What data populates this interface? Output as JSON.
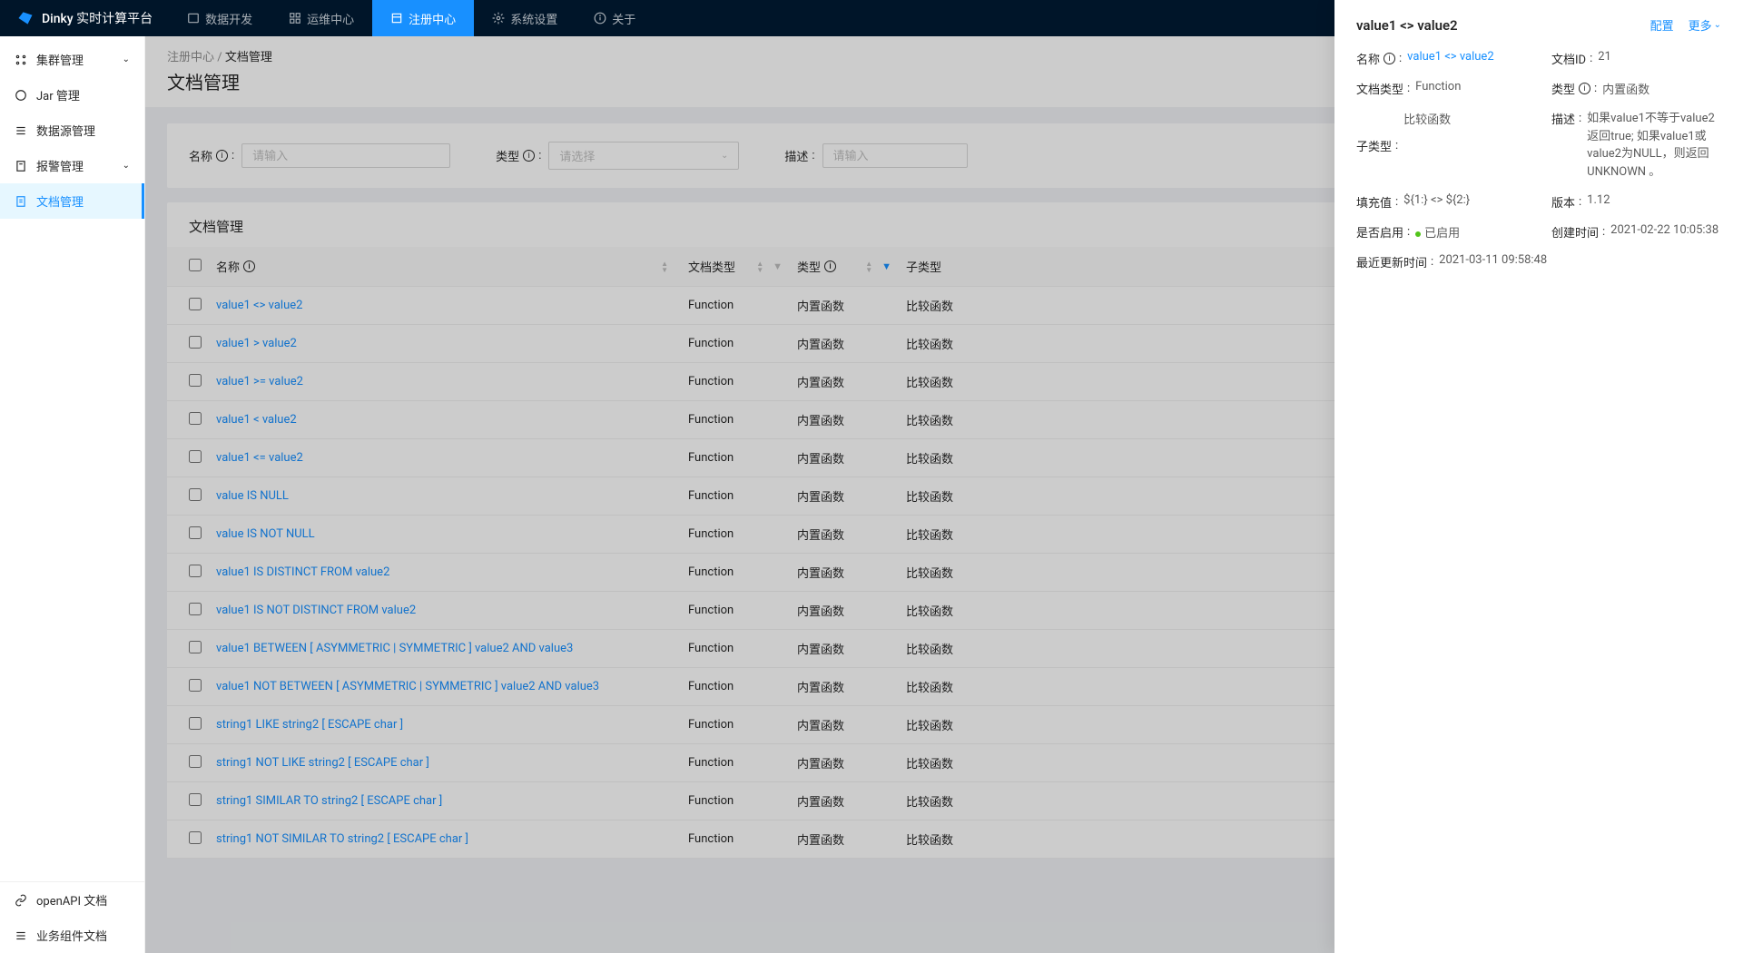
{
  "app": {
    "name": "Dinky 实时计算平台"
  },
  "nav": {
    "items": [
      {
        "label": "数据开发"
      },
      {
        "label": "运维中心"
      },
      {
        "label": "注册中心"
      },
      {
        "label": "系统设置"
      },
      {
        "label": "关于"
      }
    ]
  },
  "sidebar": {
    "items": [
      {
        "label": "集群管理",
        "expandable": true
      },
      {
        "label": "Jar 管理"
      },
      {
        "label": "数据源管理"
      },
      {
        "label": "报警管理",
        "expandable": true
      },
      {
        "label": "文档管理",
        "active": true
      }
    ],
    "bottom": [
      {
        "label": "openAPI 文档"
      },
      {
        "label": "业务组件文档"
      }
    ]
  },
  "breadcrumb": {
    "parent": "注册中心",
    "current": "文档管理"
  },
  "page": {
    "title": "文档管理"
  },
  "filters": {
    "name_label": "名称",
    "name_placeholder": "请输入",
    "type_label": "类型",
    "type_placeholder": "请选择",
    "desc_label": "描述",
    "desc_placeholder": "请输入"
  },
  "table": {
    "title": "文档管理",
    "columns": {
      "name": "名称",
      "doc_type": "文档类型",
      "type": "类型",
      "sub_type": "子类型"
    },
    "rows": [
      {
        "name": "value1 <> value2",
        "doc_type": "Function",
        "type": "内置函数",
        "sub_type": "比较函数"
      },
      {
        "name": "value1 > value2",
        "doc_type": "Function",
        "type": "内置函数",
        "sub_type": "比较函数"
      },
      {
        "name": "value1 >= value2",
        "doc_type": "Function",
        "type": "内置函数",
        "sub_type": "比较函数"
      },
      {
        "name": "value1 < value2",
        "doc_type": "Function",
        "type": "内置函数",
        "sub_type": "比较函数"
      },
      {
        "name": "value1 <= value2",
        "doc_type": "Function",
        "type": "内置函数",
        "sub_type": "比较函数"
      },
      {
        "name": "value IS NULL",
        "doc_type": "Function",
        "type": "内置函数",
        "sub_type": "比较函数"
      },
      {
        "name": "value IS NOT NULL",
        "doc_type": "Function",
        "type": "内置函数",
        "sub_type": "比较函数"
      },
      {
        "name": "value1 IS DISTINCT FROM value2",
        "doc_type": "Function",
        "type": "内置函数",
        "sub_type": "比较函数"
      },
      {
        "name": "value1 IS NOT DISTINCT FROM value2",
        "doc_type": "Function",
        "type": "内置函数",
        "sub_type": "比较函数"
      },
      {
        "name": "value1 BETWEEN [ ASYMMETRIC | SYMMETRIC ] value2 AND value3",
        "doc_type": "Function",
        "type": "内置函数",
        "sub_type": "比较函数"
      },
      {
        "name": "value1 NOT BETWEEN [ ASYMMETRIC | SYMMETRIC ] value2 AND value3",
        "doc_type": "Function",
        "type": "内置函数",
        "sub_type": "比较函数"
      },
      {
        "name": "string1 LIKE string2 [ ESCAPE char ]",
        "doc_type": "Function",
        "type": "内置函数",
        "sub_type": "比较函数"
      },
      {
        "name": "string1 NOT LIKE string2 [ ESCAPE char ]",
        "doc_type": "Function",
        "type": "内置函数",
        "sub_type": "比较函数"
      },
      {
        "name": "string1 SIMILAR TO string2 [ ESCAPE char ]",
        "doc_type": "Function",
        "type": "内置函数",
        "sub_type": "比较函数"
      },
      {
        "name": "string1 NOT SIMILAR TO string2 [ ESCAPE char ]",
        "doc_type": "Function",
        "type": "内置函数",
        "sub_type": "比较函数"
      }
    ]
  },
  "drawer": {
    "title": "value1 <> value2",
    "config": "配置",
    "more": "更多",
    "labels": {
      "name": "名称",
      "doc_id": "文档ID",
      "doc_type": "文档类型",
      "type": "类型",
      "sub_type": "子类型",
      "desc": "描述",
      "fill": "填充值",
      "version": "版本",
      "enabled": "是否启用",
      "created": "创建时间",
      "updated": "最近更新时间"
    },
    "values": {
      "name": "value1 <> value2",
      "doc_id": "21",
      "doc_type": "Function",
      "type": "内置函数",
      "sub_type": "比较函数",
      "desc": "如果value1不等于value2 返回true; 如果value1或value2为NULL，则返回UNKNOWN 。",
      "fill": "${1:} <> ${2:}",
      "version": "1.12",
      "enabled": "已启用",
      "created": "2021-02-22 10:05:38",
      "updated": "2021-03-11 09:58:48"
    }
  }
}
